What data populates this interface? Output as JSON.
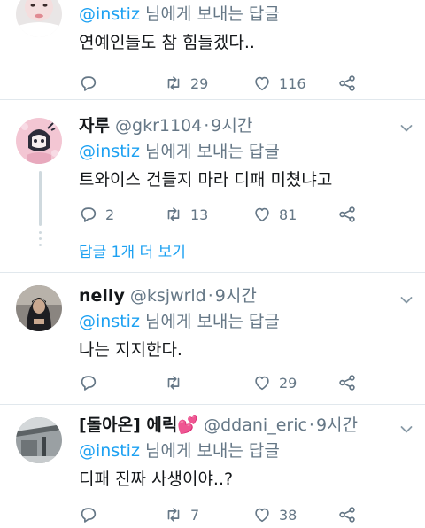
{
  "tweets": [
    {
      "reply_to": "@instiz",
      "reply_suffix": " 님에게 보내는 답글",
      "text": "연예인들도 참 힘들겠다..",
      "retweets": "29",
      "likes": "116"
    },
    {
      "name": "자루",
      "handle": "@gkr1104",
      "time": "9시간",
      "reply_to": "@instiz",
      "reply_suffix": " 님에게 보내는 답글",
      "text": "트와이스 건들지 마라 디패 미쳤냐고",
      "replies": "2",
      "retweets": "13",
      "likes": "81",
      "more_replies": "답글 1개 더 보기"
    },
    {
      "name": "nelly",
      "handle": "@ksjwrld",
      "time": "9시간",
      "reply_to": "@instiz",
      "reply_suffix": " 님에게 보내는 답글",
      "text": "나는 지지한다.",
      "likes": "29"
    },
    {
      "name": "[돌아온] 에릭",
      "name_emoji": "💕",
      "handle": "@ddani_eric",
      "time": "9시간",
      "reply_to": "@instiz",
      "reply_suffix": " 님에게 보내는 답글",
      "text": "디패 진짜 사생이야..?",
      "retweets": "7",
      "likes": "38"
    }
  ],
  "separator": "·",
  "icons": {
    "reply": "reply-icon",
    "retweet": "retweet-icon",
    "like": "heart-icon",
    "share": "share-icon",
    "more": "chevron-down-icon"
  },
  "colors": {
    "accent": "#1da1f2",
    "muted": "#657786",
    "text": "#14171a",
    "divider": "#e1e8ed"
  }
}
